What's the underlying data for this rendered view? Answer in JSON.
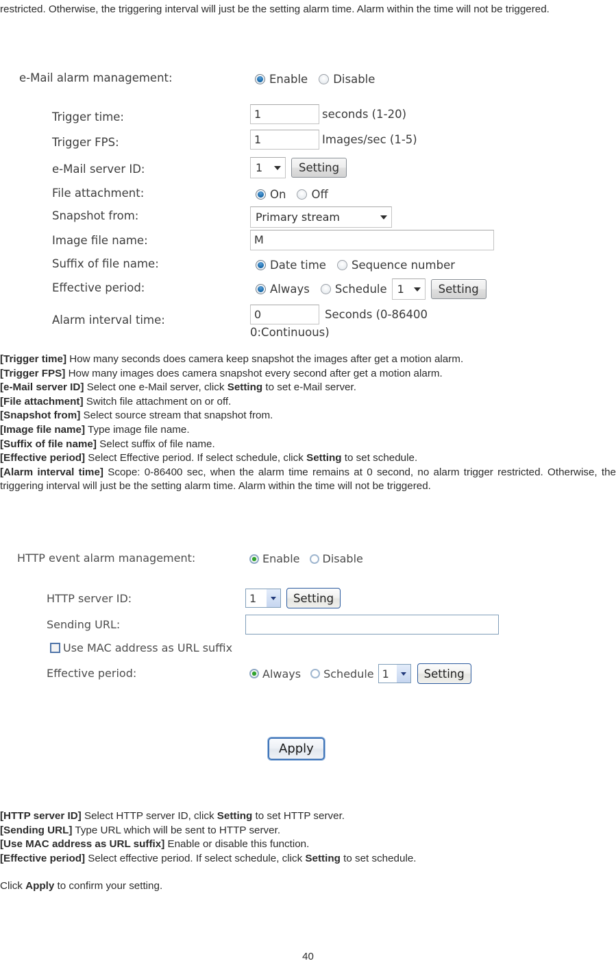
{
  "top_paragraph": {
    "text": "restricted. Otherwise, the triggering interval will just be the setting alarm time. Alarm within the time will not be triggered."
  },
  "email_form": {
    "header": {
      "label": "e-Mail alarm management:",
      "enable_label": "Enable",
      "disable_label": "Disable",
      "selected": "Enable"
    },
    "rows": {
      "trigger_time": {
        "label": "Trigger time:",
        "value": "1",
        "unit": "seconds (1-20)"
      },
      "trigger_fps": {
        "label": "Trigger FPS:",
        "value": "1",
        "unit": "Images/sec (1-5)"
      },
      "email_server_id": {
        "label": "e-Mail server ID:",
        "value": "1",
        "button": "Setting"
      },
      "file_attachment": {
        "label": "File attachment:",
        "on_label": "On",
        "off_label": "Off",
        "selected": "On"
      },
      "snapshot_from": {
        "label": "Snapshot from:",
        "value": "Primary stream"
      },
      "image_file_name": {
        "label": "Image file name:",
        "value": "M"
      },
      "suffix_of_file_name": {
        "label": "Suffix of file name:",
        "date_time_label": "Date time",
        "sequence_number_label": "Sequence number",
        "selected": "Date time"
      },
      "effective_period": {
        "label": "Effective period:",
        "always_label": "Always",
        "schedule_label": "Schedule",
        "schedule_value": "1",
        "button": "Setting",
        "selected": "Always"
      },
      "alarm_interval_time": {
        "label": "Alarm interval time:",
        "value": "0",
        "unit_line1": "Seconds (0-86400",
        "unit_line2": "0:Continuous)"
      }
    }
  },
  "email_descriptions": {
    "trigger_time": {
      "term": "[Trigger time]",
      "text": " How many seconds does camera keep snapshot the images after get a motion alarm."
    },
    "trigger_fps": {
      "term": "[Trigger FPS]",
      "text": " How many images does camera snapshot every second after get a motion alarm."
    },
    "email_server_id": {
      "term": "[e-Mail server ID]",
      "text_before": " Select one e-Mail server, click ",
      "bold_mid": "Setting",
      "text_after": " to set e-Mail server."
    },
    "file_attachment": {
      "term": "[File attachment]",
      "text": " Switch file attachment on or off."
    },
    "snapshot_from": {
      "term": "[Snapshot from]",
      "text": " Select source stream that snapshot from."
    },
    "image_file_name": {
      "term": "[Image file name]",
      "text": " Type image file name."
    },
    "suffix_of_file_name": {
      "term": "[Suffix of file name]",
      "text": " Select suffix of file name."
    },
    "effective_period": {
      "term": "[Effective period]",
      "text_before": " Select Effective period. If select schedule, click ",
      "bold_mid": "Setting",
      "text_after": " to set schedule."
    },
    "alarm_interval_time": {
      "term": "[Alarm interval time]",
      "text": " Scope: 0-86400 sec, when the alarm time remains at 0 second, no alarm trigger restricted. Otherwise, the triggering interval will just be the setting alarm time. Alarm within the time will not be triggered."
    }
  },
  "http_form": {
    "header": {
      "label": "HTTP event alarm management:",
      "enable_label": "Enable",
      "disable_label": "Disable",
      "selected": "Enable"
    },
    "rows": {
      "http_server_id": {
        "label": "HTTP server ID:",
        "value": "1",
        "button": "Setting"
      },
      "sending_url": {
        "label": "Sending URL:",
        "value": "",
        "placeholder": ""
      },
      "use_mac_suffix": {
        "label": "Use MAC address as URL suffix",
        "checked": false
      },
      "effective_period": {
        "label": "Effective period:",
        "always_label": "Always",
        "schedule_label": "Schedule",
        "schedule_value": "1",
        "button": "Setting",
        "selected": "Always"
      }
    },
    "apply_button": "Apply"
  },
  "http_descriptions": {
    "http_server_id": {
      "term": "[HTTP server ID]",
      "text_before": " Select HTTP server ID, click ",
      "bold_mid": "Setting",
      "text_after": " to set HTTP server."
    },
    "sending_url": {
      "term": "[Sending URL]",
      "text": " Type URL which will be sent to HTTP server."
    },
    "use_mac_suffix": {
      "term": "[Use MAC address as URL suffix]",
      "text": " Enable or disable this function."
    },
    "effective_period": {
      "term": "[Effective period]",
      "text_before": " Select effective period. If select schedule, click ",
      "bold_mid": "Setting",
      "text_after": " to set schedule."
    },
    "apply_note": {
      "text_before": "Click ",
      "bold_mid": "Apply",
      "text_after": " to confirm your setting."
    }
  },
  "footer": {
    "page_number": "40"
  },
  "colors": {
    "text": "#2b2b2b",
    "form_label": "#3d3d3d",
    "radio_selected_aero": "#1c6fb0",
    "radio_selected_xp": "#2fa32f",
    "xp_border": "#7f9db9",
    "apply_border": "#3f74b8"
  }
}
